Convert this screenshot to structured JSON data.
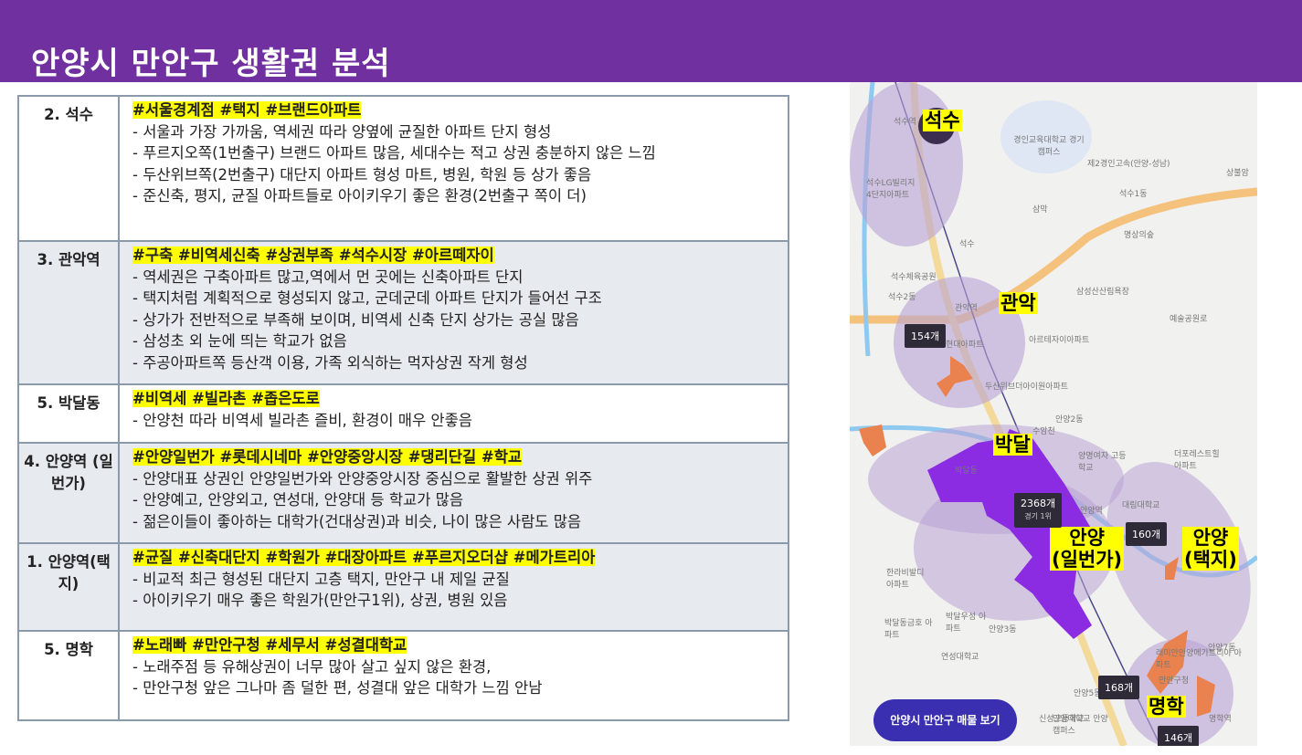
{
  "header": {
    "title": "안양시 만안구 생활권 분석"
  },
  "table": {
    "rows": [
      {
        "name": "2. 석수",
        "tags": "#서울경계점 #택지 #브랜드아파트",
        "lines": [
          "- 서울과 가장 가까움, 역세권 따라 양옆에 균질한 아파트 단지 형성",
          "- 푸르지오쪽(1번출구) 브랜드 아파트 많음, 세대수는 적고 상권 충분하지 않은 느낌",
          "- 두산위브쪽(2번출구) 대단지 아파트 형성 마트, 병원, 학원 등 상가 좋음",
          "- 준신축, 평지, 균질 아파트들로 아이키우기 좋은 환경(2번출구 쪽이 더)"
        ]
      },
      {
        "name": "3. 관악역",
        "tags": " #구축 #비역세신축 #상권부족 #석수시장 #아르떼자이",
        "lines": [
          "- 역세권은 구축아파트 많고,역에서 먼 곳에는 신축아파트 단지",
          "- 택지처럼 계획적으로 형성되지 않고, 군데군데 아파트 단지가 들어선 구조",
          "- 상가가 전반적으로 부족해 보이며, 비역세 신축 단지 상가는 공실 많음",
          "- 삼성초 외 눈에 띄는 학교가 없음",
          "- 주공아파트쪽 등산객 이용, 가족 외식하는 먹자상권 작게 형성"
        ]
      },
      {
        "name": "5. 박달동",
        "tags": "#비역세 #빌라촌 #좁은도로",
        "lines": [
          "- 안양천 따라 비역세 빌라촌 즐비, 환경이 매우 안좋음"
        ]
      },
      {
        "name": "4. 안양역 (일번가)",
        "tags": "#안양일번가 #롯데시네마 #안양중앙시장 #댕리단길 #학교",
        "lines": [
          "- 안양대표 상권인 안양일번가와 안양중앙시장 중심으로 활발한 상권 위주",
          "- 안양예고, 안양외고, 연성대, 안양대 등 학교가 많음",
          "- 젊은이들이 좋아하는 대학가(건대상권)과 비슷, 나이 많은 사람도 많음"
        ]
      },
      {
        "name": "1. 안양역(택지)",
        "tags": "#균질 #신축대단지 #학원가 #대장아파트 #푸르지오더샵 #메가트리아",
        "lines": [
          "- 비교적 최근 형성된 대단지 고층 택지, 만안구 내 제일 균질",
          "- 아이키우기 매우 좋은 학원가(만안구1위), 상권, 병원 있음"
        ]
      },
      {
        "name": "5. 명학",
        "tags": "#노래빠 #만안구청 #세무서 #성결대학교",
        "lines": [
          "- 노래주점 등 유해상권이 너무 많아 살고 싶지 않은 환경,",
          "- 만안구청 앞은 그나마 좀 덜한 편, 성결대 앞은 대학가 느낌 안남"
        ]
      }
    ]
  },
  "map": {
    "areas": [
      "석수",
      "관악",
      "박달",
      "안양\n(일번가)",
      "안양\n(택지)",
      "명학"
    ],
    "counts": [
      "154개",
      "2368개",
      "경기 1위",
      "160개",
      "168개",
      "146개"
    ],
    "places": [
      "석수역",
      "경인교육대학교 경기캠퍼스",
      "제2경인고속(안양-성남)",
      "석수1동",
      "석수LG빌리지 4단지아파트",
      "삼막",
      "석수",
      "석수체육공원",
      "석수2동",
      "관악역",
      "현대아파트",
      "아르테자이아파트",
      "삼성산산림욕장",
      "예술공원로",
      "두산위브더아이원아파트",
      "명상의숲",
      "상불암",
      "안양2동",
      "수암천",
      "박달동",
      "한라비발디 아파트",
      "양명여자 고등학교",
      "더포레스트힐 아파트",
      "안양역",
      "대림대학교",
      "박달우성 아파트",
      "박달동금호 아파트",
      "안양3동",
      "연성대학교",
      "안양5동",
      "안양대학교 안양캠퍼스",
      "래미안안양메가트리아 아파트",
      "안양7동",
      "만안구청",
      "명학역",
      "신성고등학교"
    ],
    "button": "안양시 만안구 매물 보기",
    "colors": {
      "circle": "#b9a3d6",
      "region": "#8b2be2",
      "orange": "#e9824e"
    }
  }
}
